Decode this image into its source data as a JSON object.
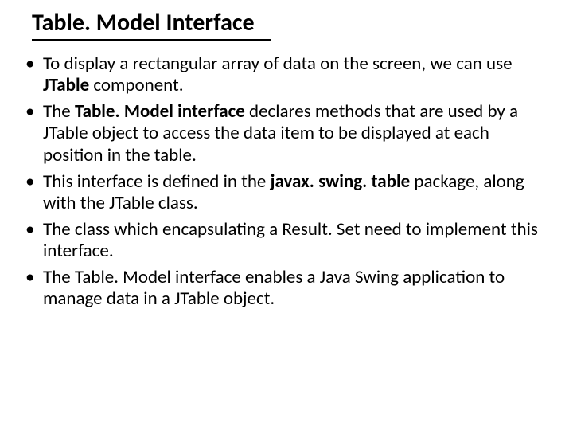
{
  "title": "Table. Model Interface",
  "bullets": [
    {
      "pre": "To display a rectangular array of data on the screen, we can use ",
      "bold": "JTable",
      "post": " component."
    },
    {
      "pre": "The ",
      "bold": "Table. Model interface",
      "post": " declares methods that are used by a JTable object to access the data item to be displayed at each position in the table."
    },
    {
      "pre": "This interface is defined in the ",
      "bold": "javax. swing. table",
      "post": " package, along with the JTable class."
    },
    {
      "pre": "The class which encapsulating a Result. Set need to implement this interface.",
      "bold": "",
      "post": ""
    },
    {
      "pre": "The Table. Model interface enables a Java Swing application to manage data in a JTable object.",
      "bold": "",
      "post": ""
    }
  ]
}
